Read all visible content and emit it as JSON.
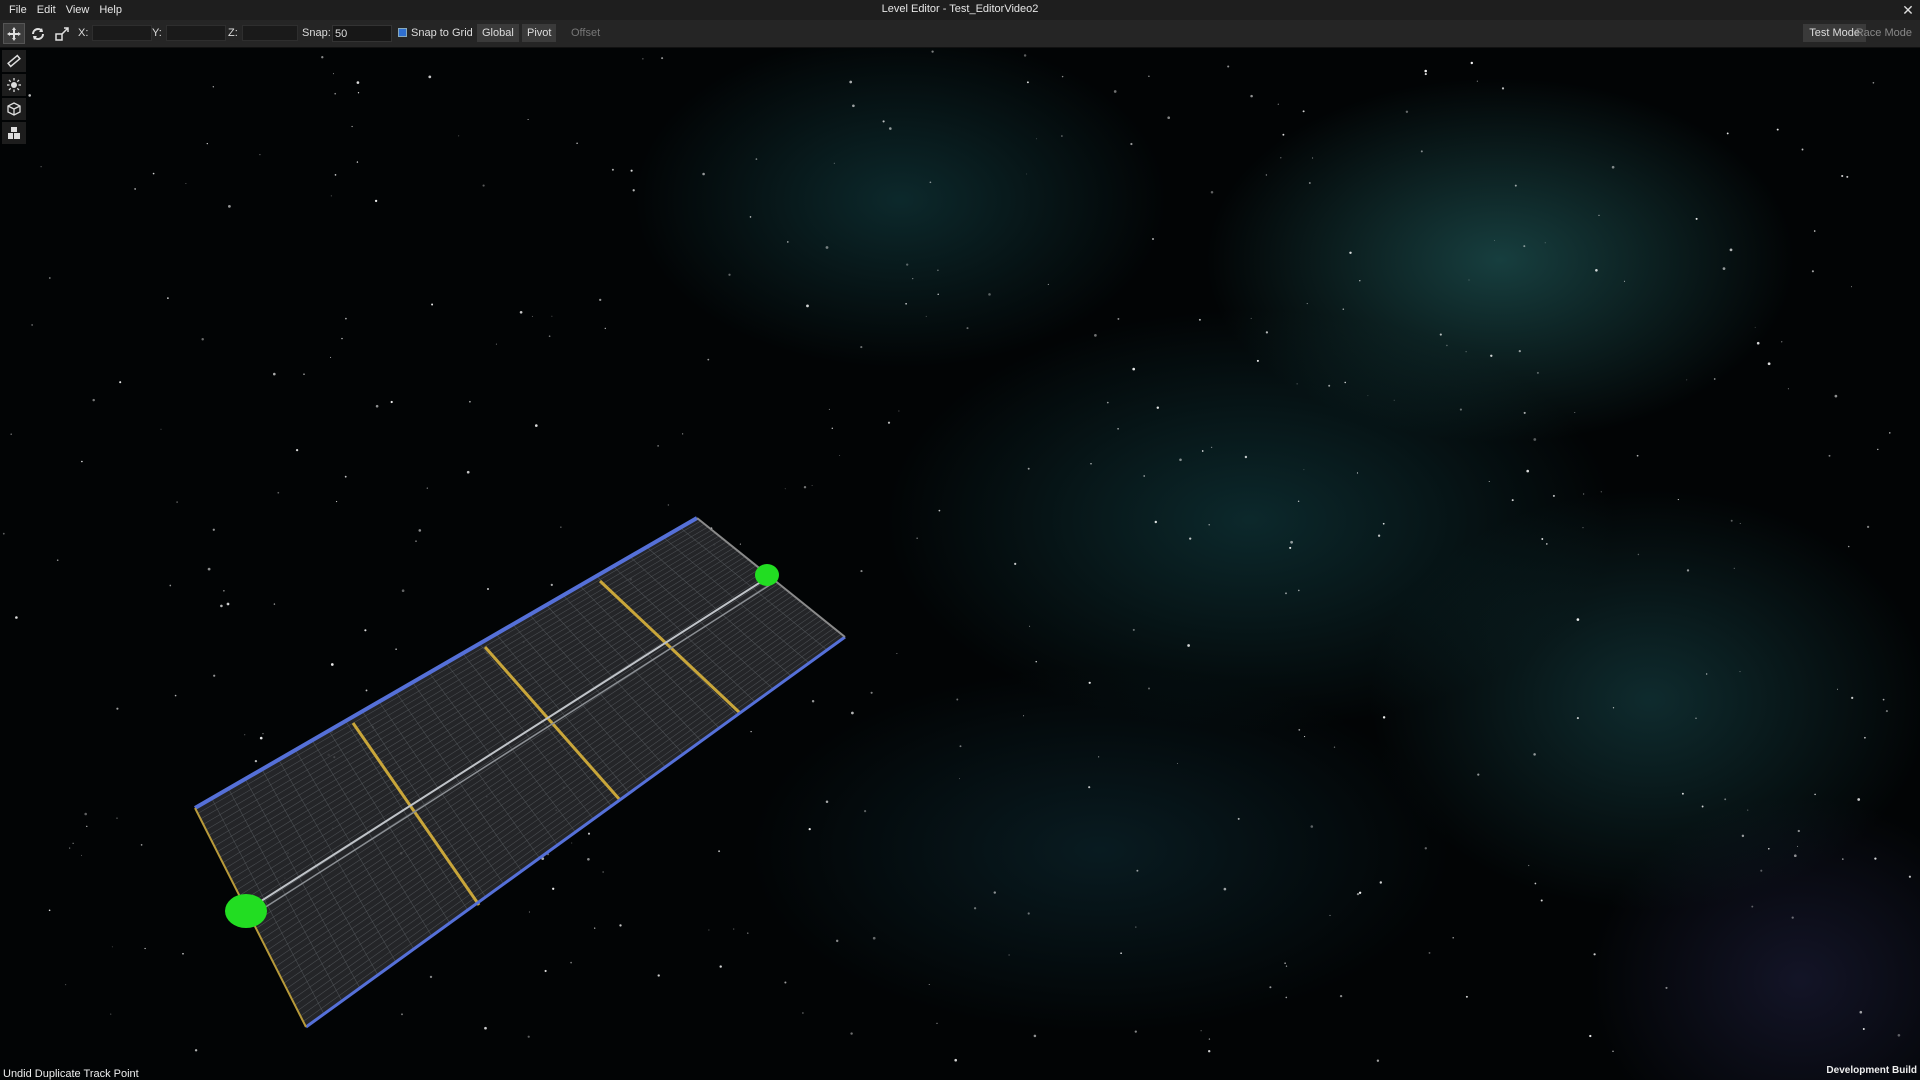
{
  "window": {
    "title": "Level Editor - Test_EditorVideo2"
  },
  "menu": {
    "items": [
      "File",
      "Edit",
      "View",
      "Help"
    ]
  },
  "toolbar": {
    "tools": [
      "move-icon",
      "rotate-icon",
      "scale-icon"
    ],
    "x_label": "X:",
    "y_label": "Y:",
    "z_label": "Z:",
    "snap_label": "Snap:",
    "snap_value": "50",
    "snap_to_grid_label": "Snap to Grid",
    "snap_to_grid_checked": true,
    "global_label": "Global",
    "pivot_label": "Pivot",
    "offset_label": "Offset",
    "test_mode_label": "Test Mode",
    "race_mode_label": "Race Mode"
  },
  "palette": {
    "tools": [
      "ruler-icon",
      "light-icon",
      "cube-icon",
      "blocks-icon"
    ]
  },
  "status": {
    "message": "Undid Duplicate Track Point",
    "build": "Development Build"
  },
  "colors": {
    "track_point": "#22dd22",
    "track_edge_left": "#5570d8",
    "track_rail": "#c9a63a",
    "menubar_bg": "#1e1e1e",
    "toolbar_bg": "#252525",
    "checkbox_accent": "#2f6fd0"
  }
}
